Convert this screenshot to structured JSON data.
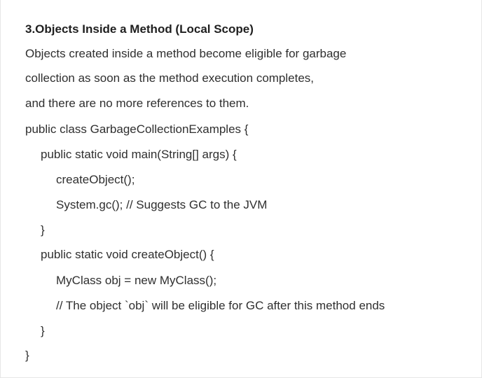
{
  "section": {
    "heading": "3.Objects Inside a Method (Local Scope)",
    "paragraph": [
      "Objects created inside a method become eligible for garbage",
      "collection as soon as the method execution completes,",
      "and there are no more references to them."
    ]
  },
  "code": {
    "lines": [
      "public class GarbageCollectionExamples {",
      "public static void main(String[] args) {",
      "createObject();",
      "System.gc(); // Suggests GC to the JVM",
      "}",
      "public static void createObject() {",
      "MyClass obj = new MyClass();",
      "// The object `obj` will be eligible for GC after this method ends",
      "}",
      "}"
    ]
  }
}
